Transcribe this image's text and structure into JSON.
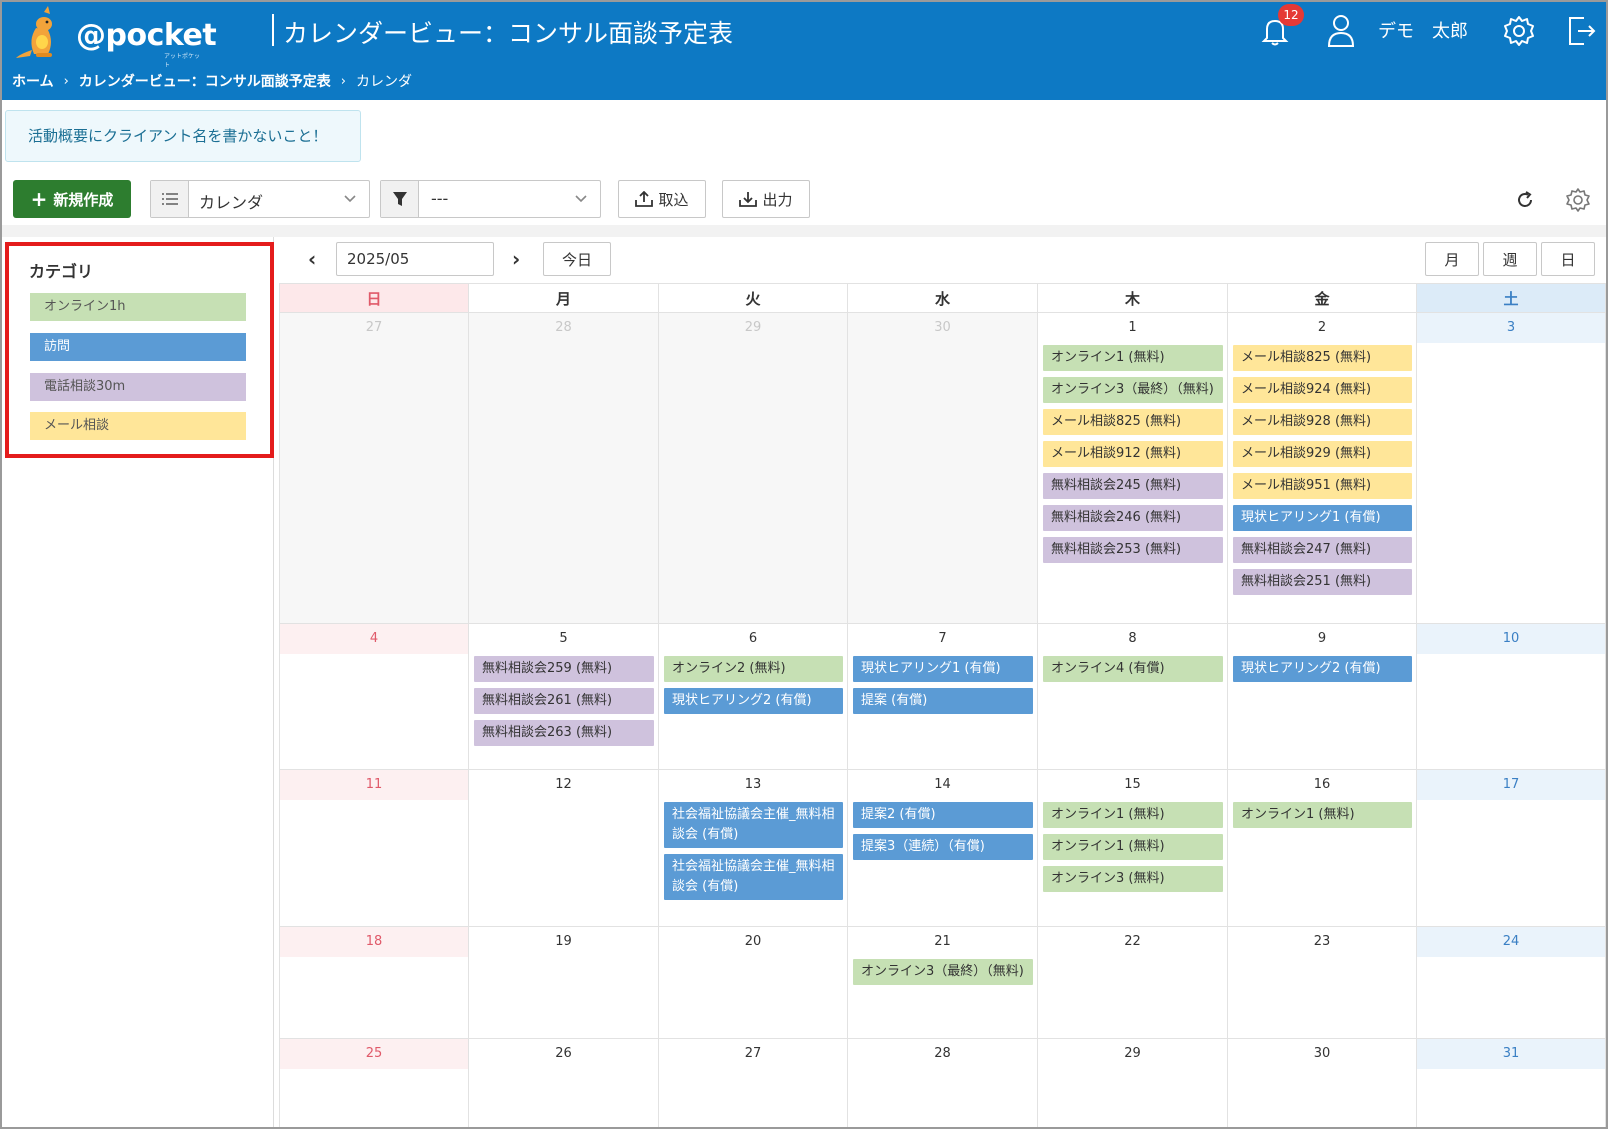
{
  "header": {
    "logo_text": "@pocket",
    "logo_sub": "アットポケット",
    "page_title": "カレンダービュー：コンサル面談予定表",
    "notification_count": "12",
    "user_name": "デモ　太郎",
    "breadcrumb": [
      "ホーム",
      "カレンダービュー：コンサル面談予定表",
      "カレンダ"
    ]
  },
  "notice": "活動概要にクライアント名を書かないこと！",
  "toolbar": {
    "new_label": "新規作成",
    "view_value": "カレンダ",
    "filter_value": "---",
    "import_label": "取込",
    "export_label": "出力"
  },
  "categories": {
    "title": "カテゴリ",
    "items": [
      {
        "label": "オンライン1h",
        "color": "#c6e0b4"
      },
      {
        "label": "訪問",
        "color": "#5b9bd5"
      },
      {
        "label": "電話相談30m",
        "color": "#cfc2dd"
      },
      {
        "label": "メール相談",
        "color": "#ffe699"
      }
    ]
  },
  "calendar_nav": {
    "month": "2025/05",
    "today_label": "今日",
    "view_month": "月",
    "view_week": "週",
    "view_day": "日"
  },
  "weekdays": [
    "日",
    "月",
    "火",
    "水",
    "木",
    "金",
    "土"
  ],
  "colors": {
    "header_bg": "#0d79c4",
    "sunday": "#e05a6a",
    "saturday": "#3a7fc4",
    "new_button": "#2d7d2f"
  },
  "weeks": [
    {
      "days": [
        {
          "num": "27",
          "other": true,
          "events": []
        },
        {
          "num": "28",
          "other": true,
          "events": []
        },
        {
          "num": "29",
          "other": true,
          "events": []
        },
        {
          "num": "30",
          "other": true,
          "events": []
        },
        {
          "num": "1",
          "events": [
            {
              "t": "オンライン1 (無料)",
              "c": "green"
            },
            {
              "t": "オンライン3（最終）（無料)",
              "c": "green"
            },
            {
              "t": "メール相談825 (無料)",
              "c": "yellow"
            },
            {
              "t": "メール相談912 (無料)",
              "c": "yellow"
            },
            {
              "t": "無料相談会245 (無料)",
              "c": "purple"
            },
            {
              "t": "無料相談会246 (無料)",
              "c": "purple"
            },
            {
              "t": "無料相談会253 (無料)",
              "c": "purple"
            }
          ]
        },
        {
          "num": "2",
          "events": [
            {
              "t": "メール相談825 (無料)",
              "c": "yellow"
            },
            {
              "t": "メール相談924 (無料)",
              "c": "yellow"
            },
            {
              "t": "メール相談928 (無料)",
              "c": "yellow"
            },
            {
              "t": "メール相談929 (無料)",
              "c": "yellow"
            },
            {
              "t": "メール相談951 (無料)",
              "c": "yellow"
            },
            {
              "t": "現状ヒアリング1 (有償)",
              "c": "blue"
            },
            {
              "t": "無料相談会247 (無料)",
              "c": "purple"
            },
            {
              "t": "無料相談会251 (無料)",
              "c": "purple"
            }
          ]
        },
        {
          "num": "3",
          "events": []
        }
      ]
    },
    {
      "days": [
        {
          "num": "4",
          "events": []
        },
        {
          "num": "5",
          "events": [
            {
              "t": "無料相談会259 (無料)",
              "c": "purple"
            },
            {
              "t": "無料相談会261 (無料)",
              "c": "purple"
            },
            {
              "t": "無料相談会263 (無料)",
              "c": "purple"
            }
          ]
        },
        {
          "num": "6",
          "events": [
            {
              "t": "オンライン2 (無料)",
              "c": "green"
            },
            {
              "t": "現状ヒアリング2 (有償)",
              "c": "blue"
            }
          ]
        },
        {
          "num": "7",
          "events": [
            {
              "t": "現状ヒアリング1 (有償)",
              "c": "blue"
            },
            {
              "t": "提案 (有償)",
              "c": "blue"
            }
          ]
        },
        {
          "num": "8",
          "events": [
            {
              "t": "オンライン4 (有償)",
              "c": "green"
            }
          ]
        },
        {
          "num": "9",
          "events": [
            {
              "t": "現状ヒアリング2 (有償)",
              "c": "blue"
            }
          ]
        },
        {
          "num": "10",
          "events": []
        }
      ]
    },
    {
      "days": [
        {
          "num": "11",
          "events": []
        },
        {
          "num": "12",
          "events": []
        },
        {
          "num": "13",
          "events": [
            {
              "t": "社会福祉協議会主催_無料相談会 (有償)",
              "c": "blue"
            },
            {
              "t": "社会福祉協議会主催_無料相談会 (有償)",
              "c": "blue"
            }
          ]
        },
        {
          "num": "14",
          "events": [
            {
              "t": "提案2 (有償)",
              "c": "blue"
            },
            {
              "t": "提案3（連続）（有償)",
              "c": "blue"
            }
          ]
        },
        {
          "num": "15",
          "events": [
            {
              "t": "オンライン1 (無料)",
              "c": "green"
            },
            {
              "t": "オンライン1 (無料)",
              "c": "green"
            },
            {
              "t": "オンライン3 (無料)",
              "c": "green"
            }
          ]
        },
        {
          "num": "16",
          "events": [
            {
              "t": "オンライン1 (無料)",
              "c": "green"
            }
          ]
        },
        {
          "num": "17",
          "events": []
        }
      ]
    },
    {
      "days": [
        {
          "num": "18",
          "events": []
        },
        {
          "num": "19",
          "events": []
        },
        {
          "num": "20",
          "events": []
        },
        {
          "num": "21",
          "events": [
            {
              "t": "オンライン3（最終）（無料)",
              "c": "green"
            }
          ]
        },
        {
          "num": "22",
          "events": []
        },
        {
          "num": "23",
          "events": []
        },
        {
          "num": "24",
          "events": []
        }
      ]
    },
    {
      "days": [
        {
          "num": "25",
          "events": []
        },
        {
          "num": "26",
          "events": []
        },
        {
          "num": "27",
          "events": []
        },
        {
          "num": "28",
          "events": []
        },
        {
          "num": "29",
          "events": []
        },
        {
          "num": "30",
          "events": []
        },
        {
          "num": "31",
          "events": []
        }
      ]
    }
  ]
}
